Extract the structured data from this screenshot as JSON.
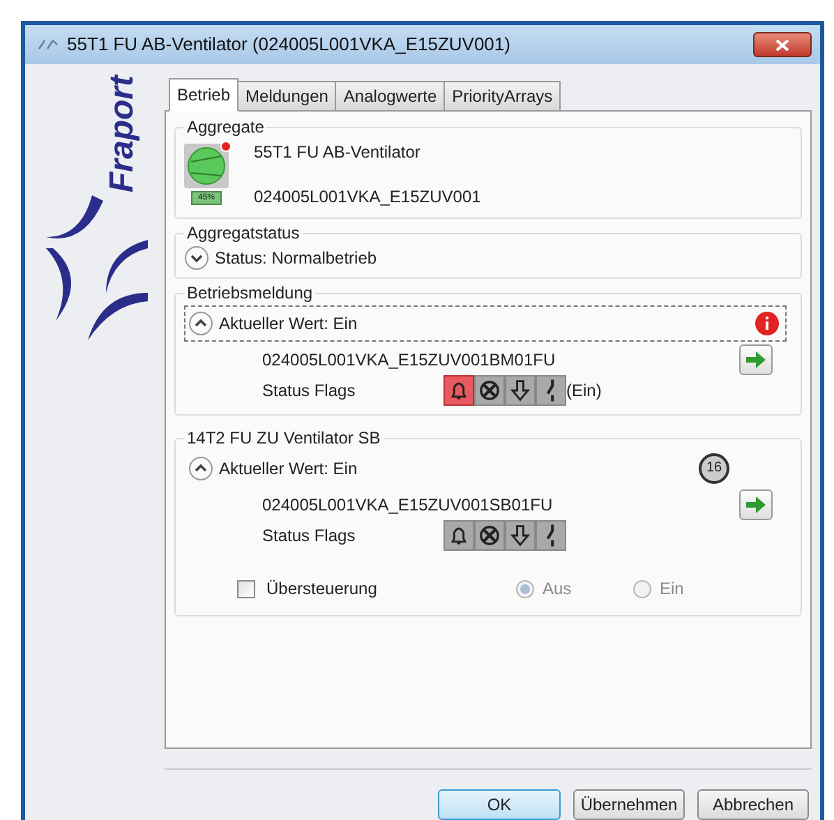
{
  "window": {
    "title": "55T1 FU AB-Ventilator (024005L001VKA_E15ZUV001)"
  },
  "logo": {
    "text": "Fraport"
  },
  "tabs": [
    {
      "label": "Betrieb",
      "selected": true
    },
    {
      "label": "Meldungen",
      "selected": false
    },
    {
      "label": "Analogwerte",
      "selected": false
    },
    {
      "label": "PriorityArrays",
      "selected": false
    }
  ],
  "aggregate": {
    "legend": "Aggregate",
    "name": "55T1 FU AB-Ventilator",
    "id": "024005L001VKA_E15ZUV001",
    "percent": "45%",
    "alarm": true
  },
  "aggregate_status": {
    "legend": "Aggregatstatus",
    "expanded": false,
    "status": "Status: Normalbetrieb"
  },
  "sections": [
    {
      "legend": "Betriebsmeldung",
      "expanded": true,
      "focused": true,
      "value": "Aktueller Wert: Ein",
      "indicator": {
        "kind": "alarm"
      },
      "object_id": "024005L001VKA_E15ZUV001BM01FU",
      "flags_label": "Status Flags",
      "flags": [
        {
          "kind": "alarm",
          "active": true
        },
        {
          "kind": "fault",
          "active": false
        },
        {
          "kind": "overridden",
          "active": false
        },
        {
          "kind": "out_of_service",
          "active": false
        }
      ],
      "flags_note": "(Ein)"
    },
    {
      "legend": "14T2 FU ZU Ventilator SB",
      "expanded": true,
      "focused": false,
      "value": "Aktueller Wert: Ein",
      "indicator": {
        "kind": "priority",
        "text": "16"
      },
      "object_id": "024005L001VKA_E15ZUV001SB01FU",
      "flags_label": "Status Flags",
      "flags": [
        {
          "kind": "alarm",
          "active": false
        },
        {
          "kind": "fault",
          "active": false
        },
        {
          "kind": "overridden",
          "active": false
        },
        {
          "kind": "out_of_service",
          "active": false
        }
      ],
      "override": {
        "label": "Übersteuerung",
        "checked": false,
        "options": [
          {
            "label": "Aus",
            "selected": true,
            "disabled": true
          },
          {
            "label": "Ein",
            "selected": false,
            "disabled": true
          }
        ]
      }
    }
  ],
  "buttons": [
    {
      "label": "OK",
      "default": true
    },
    {
      "label": "Übernehmen",
      "default": false
    },
    {
      "label": "Abbrechen",
      "default": false
    }
  ]
}
